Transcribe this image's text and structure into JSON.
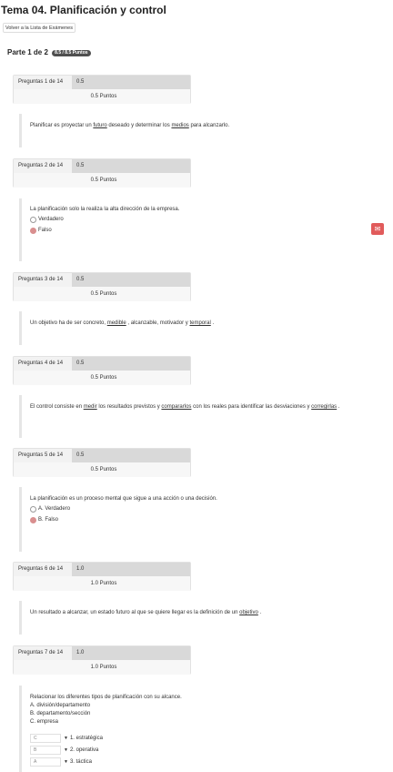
{
  "page": {
    "title": "Tema 04. Planificación y control",
    "back_label": "Volver a la Lista de Exámenes",
    "part_label": "Parte 1 de 2",
    "part_badge": "8.5 / 8.5 Puntos"
  },
  "questions": [
    {
      "header": "Preguntas 1 de 14",
      "score": "0.5",
      "points": "0.5 Puntos",
      "segments": [
        "Planificar es proyectar un ",
        "futuro",
        " deseado y determinar los ",
        "medios",
        " para alcanzarlo."
      ]
    },
    {
      "header": "Preguntas 2 de 14",
      "score": "0.5",
      "points": "0.5 Puntos",
      "text": "La planificación solo la realiza la alta dirección de la empresa.",
      "options": [
        "Verdadero",
        "Falso"
      ],
      "selected": 1
    },
    {
      "header": "Preguntas 3 de 14",
      "score": "0.5",
      "points": "0.5 Puntos",
      "segments": [
        "Un objetivo ha de ser concreto, ",
        "medible",
        " , alcanzable, motivador y ",
        "temporal",
        " ."
      ]
    },
    {
      "header": "Preguntas 4 de 14",
      "score": "0.5",
      "points": "0.5 Puntos",
      "segments": [
        "El control consiste en ",
        "medir",
        " los resultados previstos y ",
        "compararlos",
        " con los reales para identificar las desviaciones y ",
        "corregirlas",
        " ."
      ]
    },
    {
      "header": "Preguntas 5 de 14",
      "score": "0.5",
      "points": "0.5 Puntos",
      "text": "La planificación es un proceso mental que sigue a una acción o una decisión.",
      "options": [
        "A. Verdadero",
        "B. Falso"
      ],
      "selected": 1
    },
    {
      "header": "Preguntas 6 de 14",
      "score": "1.0",
      "points": "1.0 Puntos",
      "segments": [
        "Un resultado a alcanzar, un estado futuro al que se quiere llegar es la definición de un ",
        "objetivo",
        " ."
      ]
    },
    {
      "header": "Preguntas 7 de 14",
      "score": "1.0",
      "points": "1.0 Puntos",
      "text": "Relacionar los diferentes tipos de planificación con su alcance.",
      "items": [
        "A. división/departamento",
        "B. departamento/sección",
        "C. empresa"
      ],
      "matches": [
        {
          "value": "C",
          "label": "1. estratégica"
        },
        {
          "value": "B",
          "label": "2. operativa"
        },
        {
          "value": "A",
          "label": "3. táctica"
        }
      ]
    }
  ]
}
